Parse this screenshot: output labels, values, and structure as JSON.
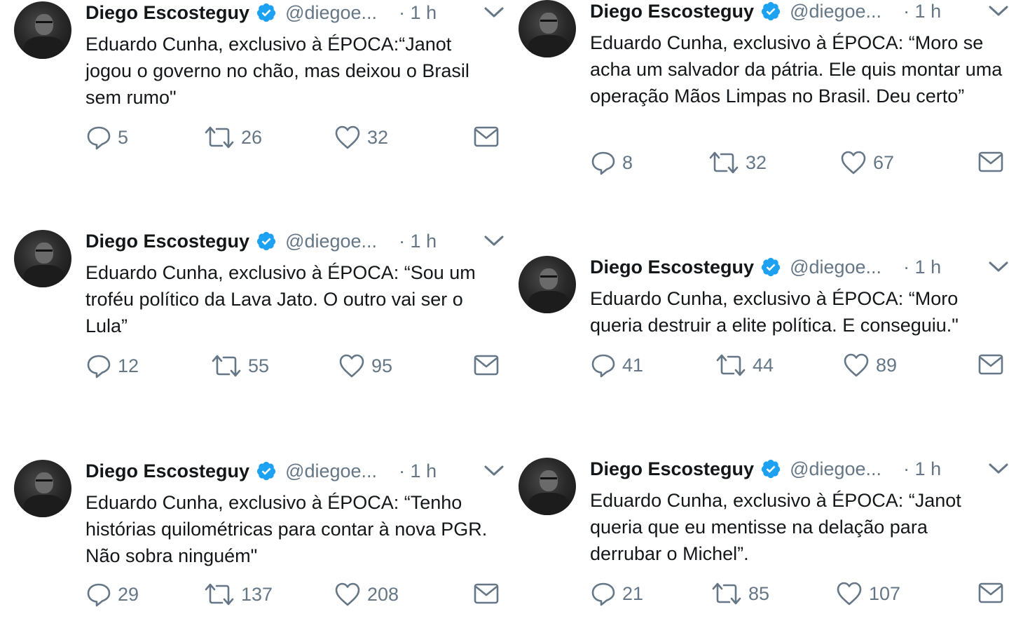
{
  "tweets": [
    {
      "name": "Diego Escosteguy",
      "handle": "@diegoe...",
      "time": "· 1 h",
      "text": "Eduardo Cunha, exclusivo à ÉPOCA:“Janot jogou o governo no chão, mas deixou o Brasil sem rumo\"",
      "replies": "5",
      "retweets": "26",
      "likes": "32"
    },
    {
      "name": "Diego Escosteguy",
      "handle": "@diegoe...",
      "time": "· 1 h",
      "text": "Eduardo Cunha, exclusivo à ÉPOCA: “Moro se acha um salvador da pátria. Ele quis montar uma operação Mãos Limpas no Brasil. Deu certo”",
      "replies": "8",
      "retweets": "32",
      "likes": "67"
    },
    {
      "name": "Diego Escosteguy",
      "handle": "@diegoe...",
      "time": "· 1 h",
      "text": "Eduardo Cunha, exclusivo à ÉPOCA: “Sou um troféu político da Lava Jato. O outro vai ser o Lula”",
      "replies": "12",
      "retweets": "55",
      "likes": "95"
    },
    {
      "name": "Diego Escosteguy",
      "handle": "@diegoe...",
      "time": "· 1 h",
      "text": "Eduardo Cunha, exclusivo à ÉPOCA: “Moro queria destruir a elite política. E conseguiu.\"",
      "replies": "41",
      "retweets": "44",
      "likes": "89"
    },
    {
      "name": "Diego Escosteguy",
      "handle": "@diegoe...",
      "time": "· 1 h",
      "text": "Eduardo Cunha, exclusivo à ÉPOCA: “Tenho histórias quilométricas para contar à nova PGR. Não sobra ninguém\"",
      "replies": "29",
      "retweets": "137",
      "likes": "208"
    },
    {
      "name": "Diego Escosteguy",
      "handle": "@diegoe...",
      "time": "· 1 h",
      "text": "Eduardo Cunha, exclusivo à ÉPOCA: “Janot queria que eu mentisse na delação para derrubar o Michel”.",
      "replies": "21",
      "retweets": "85",
      "likes": "107"
    }
  ],
  "icons": {
    "verified": "verified-badge-icon",
    "caret": "chevron-down-icon",
    "reply": "reply-icon",
    "retweet": "retweet-icon",
    "like": "heart-icon",
    "dm": "envelope-icon"
  },
  "colors": {
    "verified": "#1da1f2",
    "muted": "#657786",
    "text": "#14171a"
  }
}
